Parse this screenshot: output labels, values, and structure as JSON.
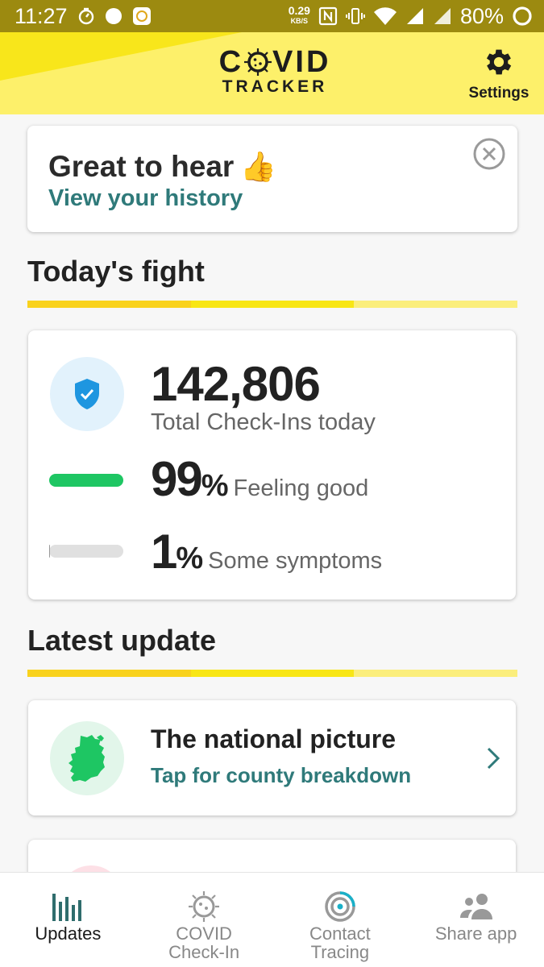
{
  "status_bar": {
    "time": "11:27",
    "net_speed_value": "0.29",
    "net_speed_unit": "KB/S",
    "battery": "80%"
  },
  "header": {
    "logo_line1_a": "C",
    "logo_line1_b": "VID",
    "logo_line2": "TRACKER",
    "settings_label": "Settings"
  },
  "notice": {
    "title": "Great to hear",
    "emoji": "👍",
    "link": "View your history"
  },
  "fight": {
    "section_title": "Today's fight",
    "total": "142,806",
    "total_label": "Total Check-Ins today",
    "good_value": "99",
    "good_pct": 99,
    "good_label": "Feeling good",
    "symptom_value": "1",
    "symptom_pct": 1,
    "symptom_label": "Some symptoms",
    "percent_sign": "%"
  },
  "latest": {
    "section_title": "Latest update",
    "title": "The national picture",
    "subtitle": "Tap for county breakdown"
  },
  "nav": {
    "items": [
      {
        "label_line1": "Updates",
        "label_line2": "",
        "icon": "bar-chart-icon",
        "active": true
      },
      {
        "label_line1": "COVID",
        "label_line2": "Check-In",
        "icon": "virus-icon",
        "active": false
      },
      {
        "label_line1": "Contact",
        "label_line2": "Tracing",
        "icon": "contact-tracing-icon",
        "active": false
      },
      {
        "label_line1": "Share app",
        "label_line2": "",
        "icon": "people-icon",
        "active": false
      }
    ]
  },
  "colors": {
    "status_bar": "#9c8a10",
    "header_yellow": "#fdf06a",
    "teal_link": "#2f7a7a",
    "good_green": "#1ec663",
    "shield_blue": "#1e96e0"
  }
}
